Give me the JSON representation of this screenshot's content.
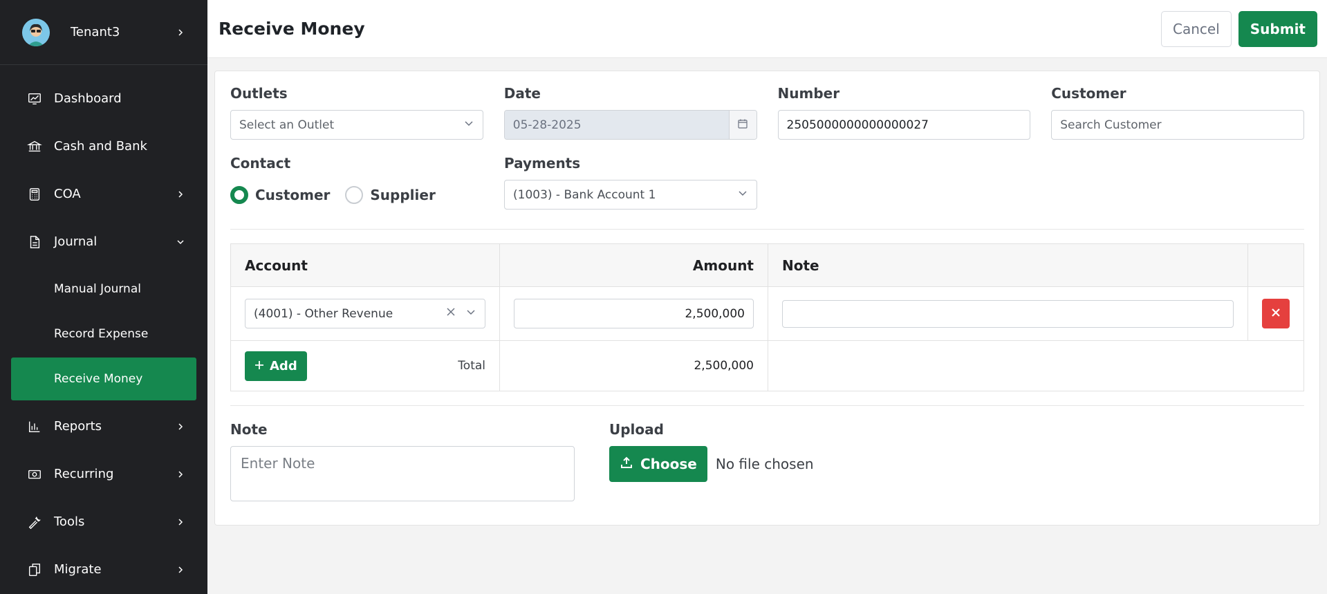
{
  "sidebar": {
    "tenant": {
      "name": "Tenant3"
    },
    "items": [
      {
        "label": "Dashboard",
        "icon": "chart-line-icon"
      },
      {
        "label": "Cash and Bank",
        "icon": "bank-icon"
      },
      {
        "label": "COA",
        "icon": "calculator-icon"
      },
      {
        "label": "Journal",
        "icon": "document-icon"
      },
      {
        "label": "Reports",
        "icon": "bar-chart-icon"
      },
      {
        "label": "Recurring",
        "icon": "money-icon"
      },
      {
        "label": "Tools",
        "icon": "wrench-icon"
      },
      {
        "label": "Migrate",
        "icon": "copy-icon"
      }
    ],
    "journal_sub": [
      {
        "label": "Manual Journal"
      },
      {
        "label": "Record Expense"
      },
      {
        "label": "Receive Money",
        "active": true
      }
    ],
    "active_color": "#15884f"
  },
  "header": {
    "title": "Receive Money",
    "cancel_label": "Cancel",
    "submit_label": "Submit"
  },
  "form": {
    "outlets": {
      "label": "Outlets",
      "placeholder": "Select an Outlet"
    },
    "date": {
      "label": "Date",
      "value": "05-28-2025"
    },
    "number": {
      "label": "Number",
      "value": "2505000000000000027"
    },
    "customer": {
      "label": "Customer",
      "placeholder": "Search Customer"
    },
    "contact": {
      "label": "Contact",
      "options": [
        "Customer",
        "Supplier"
      ],
      "selected": "Customer"
    },
    "payments": {
      "label": "Payments",
      "value": "(1003)  -  Bank Account 1"
    }
  },
  "table": {
    "headers": {
      "account": "Account",
      "amount": "Amount",
      "note": "Note"
    },
    "rows": [
      {
        "account": "(4001)  -  Other Revenue",
        "amount": "2,500,000",
        "note": ""
      }
    ],
    "add_label": "Add",
    "total_label": "Total",
    "total_value": "2,500,000"
  },
  "note": {
    "label": "Note",
    "placeholder": "Enter Note"
  },
  "upload": {
    "label": "Upload",
    "button_label": "Choose",
    "status": "No file chosen"
  },
  "colors": {
    "primary": "#15884f",
    "danger": "#e5403e",
    "sidebar_bg": "#202124"
  }
}
